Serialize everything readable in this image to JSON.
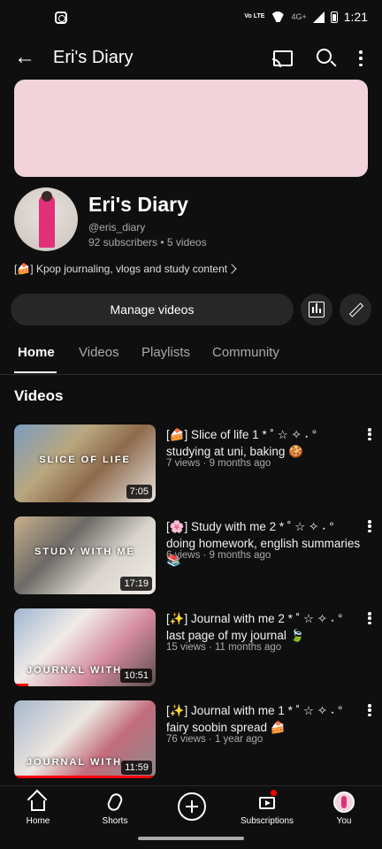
{
  "status": {
    "time": "1:21",
    "volte": "Vo LTE",
    "network": "4G+"
  },
  "header": {
    "title": "Eri's Diary"
  },
  "channel": {
    "name": "Eri's Diary",
    "handle": "@eris_diary",
    "stats": "92 subscribers • 5 videos",
    "description": "[🍰] Kpop journaling, vlogs and study content",
    "banner_color": "#f2d3db"
  },
  "actions": {
    "manage_label": "Manage videos"
  },
  "tabs": [
    {
      "label": "Home"
    },
    {
      "label": "Videos"
    },
    {
      "label": "Playlists"
    },
    {
      "label": "Community"
    }
  ],
  "section": {
    "title": "Videos"
  },
  "videos": [
    {
      "title": "[🍰] Slice of life 1 * ˚ ☆ ✧ ˖ ° studying at uni, baking 🍪",
      "meta": "7 views · 9 months ago",
      "duration": "7:05",
      "overlay": "SLICE OF LIFE",
      "watched": 0.0
    },
    {
      "title": "[🌸] Study with me 2 * ˚ ☆ ✧ ˖ ° doing homework, english summaries 📚",
      "meta": "6 views · 9 months ago",
      "duration": "17:19",
      "overlay": "STUDY WITH ME",
      "watched": 0.0
    },
    {
      "title": "[✨] Journal with me 2 * ˚ ☆ ✧ ˖ ° last page of my journal 🍃",
      "meta": "15 views · 11 months ago",
      "duration": "10:51",
      "overlay": "JOURNAL WITH",
      "watched": 0.1
    },
    {
      "title": "[✨] Journal with me 1 * ˚ ☆ ✧ ˖ ° fairy soobin spread 🍰",
      "meta": "76 views · 1 year ago",
      "duration": "11:59",
      "overlay": "JOURNAL WITH",
      "watched": 1.0
    }
  ],
  "nav": [
    {
      "label": "Home"
    },
    {
      "label": "Shorts"
    },
    {
      "label": ""
    },
    {
      "label": "Subscriptions"
    },
    {
      "label": "You"
    }
  ]
}
